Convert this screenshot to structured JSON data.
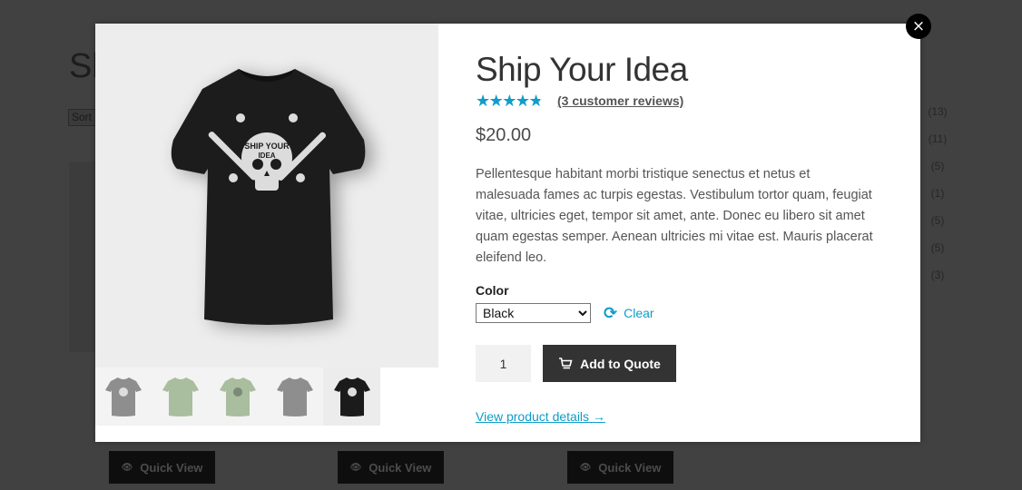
{
  "background": {
    "page_title": "Sh",
    "sort_label": "Sort",
    "category_counts": [
      "(13)",
      "(11)",
      "(5)",
      "(1)",
      "(5)",
      "(5)",
      "(3)"
    ],
    "quick_view_buttons": [
      {
        "label": "Quick View",
        "icon": "eye-icon"
      },
      {
        "label": "Quick View",
        "icon": "eye-icon"
      },
      {
        "label": "Quick View",
        "icon": "eye-icon"
      }
    ]
  },
  "modal": {
    "close_icon": "×",
    "gallery": {
      "main_image_alt": "Black t-shirt with Ship Your Idea skull print",
      "thumbnails": [
        {
          "color": "#8e8e8e",
          "print": true,
          "active": false
        },
        {
          "color": "#a9bd9f",
          "print": false,
          "active": false
        },
        {
          "color": "#a9bd9f",
          "print": true,
          "active": false
        },
        {
          "color": "#8e8e8e",
          "print": false,
          "active": false
        },
        {
          "color": "#1b1b1b",
          "print": true,
          "active": true
        }
      ]
    },
    "product": {
      "title": "Ship Your Idea",
      "rating": 4.33,
      "rating_max": 5,
      "reviews_link": "(3 customer reviews)",
      "price": "$20.00",
      "description": "Pellentesque habitant morbi tristique senectus et netus et malesuada fames ac turpis egestas. Vestibulum tortor quam, feugiat vitae, ultricies eget, tempor sit amet, ante. Donec eu libero sit amet quam egestas semper. Aenean ultricies mi vitae est. Mauris placerat eleifend leo.",
      "color_label": "Color",
      "color_selected": "Black",
      "clear_label": "Clear",
      "quantity": "1",
      "add_button_label": "Add to Quote",
      "details_link": "View product details →"
    }
  },
  "colors": {
    "accent": "#0f9dc9",
    "button_dark": "#333333",
    "overlay": "#414141"
  }
}
